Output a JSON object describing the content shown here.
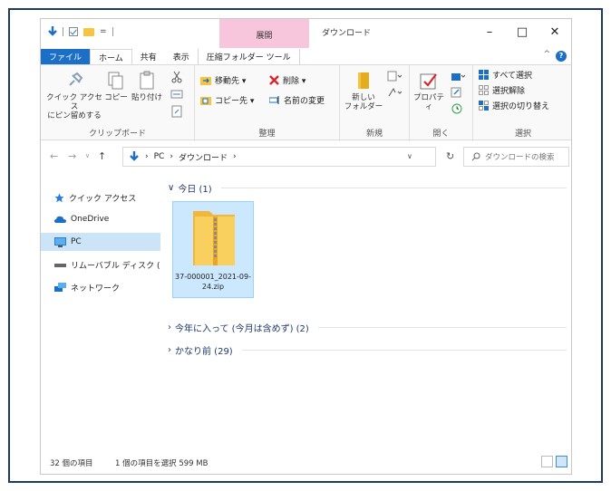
{
  "window": {
    "title": "ダウンロード",
    "context_tab_header": "展開",
    "buttons": {
      "minimize": "–",
      "maximize": "□",
      "close": "✕"
    }
  },
  "quick_access_toolbar": {
    "dropdown": "="
  },
  "ribbon": {
    "tabs": [
      "ファイル",
      "ホーム",
      "共有",
      "表示",
      "圧縮フォルダー ツール"
    ],
    "help": "?",
    "collapse": "^",
    "clipboard": {
      "label": "クリップボード",
      "pin_label_1": "クイック アクセス",
      "pin_label_2": "にピン留めする",
      "copy": "コピー",
      "paste": "貼り付け"
    },
    "organize": {
      "label": "整理",
      "move_to": "移動先 ▾",
      "copy_to": "コピー先 ▾",
      "delete": "削除 ▾",
      "rename": "名前の変更"
    },
    "new": {
      "label": "新規",
      "new_folder_1": "新しい",
      "new_folder_2": "フォルダー"
    },
    "open": {
      "label": "開く",
      "properties": "プロパティ"
    },
    "select": {
      "label": "選択",
      "select_all": "すべて選択",
      "select_none": "選択解除",
      "invert": "選択の切り替え"
    }
  },
  "address_bar": {
    "path": [
      "PC",
      "ダウンロード"
    ],
    "search_placeholder": "ダウンロードの検索"
  },
  "nav_pane": {
    "items": [
      "クイック アクセス",
      "OneDrive",
      "PC",
      "リムーバブル ディスク (",
      "ネットワーク"
    ],
    "selected": "PC"
  },
  "content": {
    "groups": [
      {
        "label": "今日 (1)",
        "expanded": true
      },
      {
        "label": "今年に入って (今月は含めず) (2)",
        "expanded": false
      },
      {
        "label": "かなり前 (29)",
        "expanded": false
      }
    ],
    "file": {
      "name": "37-000001_2021-09-24.zip"
    }
  },
  "status_bar": {
    "count": "32 個の項目",
    "selection": "1 個の項目を選択 599 MB"
  },
  "colors": {
    "file_tab": "#1c6fc7",
    "context_tab": "#f7c6dc",
    "selection": "#cce8ff",
    "folder": "#f5c542",
    "frame": "#1f3b63"
  }
}
